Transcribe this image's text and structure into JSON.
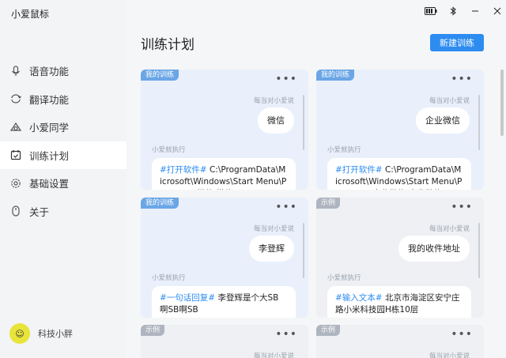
{
  "app": {
    "title": "小爱鼠标"
  },
  "topbar": {
    "battery_icon": "battery-icon",
    "bluetooth_icon": "bluetooth-icon"
  },
  "nav": {
    "items": [
      {
        "label": "语音功能",
        "icon": "microphone-icon",
        "active": false
      },
      {
        "label": "翻译功能",
        "icon": "refresh-icon",
        "active": false
      },
      {
        "label": "小爱同学",
        "icon": "xiaoai-icon",
        "active": false
      },
      {
        "label": "训练计划",
        "icon": "calendar-icon",
        "active": true
      },
      {
        "label": "基础设置",
        "icon": "gear-icon",
        "active": false
      },
      {
        "label": "关于",
        "icon": "mouse-icon",
        "active": false
      }
    ]
  },
  "user": {
    "name": "科技小胖"
  },
  "page": {
    "title": "训练计划",
    "new_button": "新建训练"
  },
  "cards": [
    {
      "tag": "我的训练",
      "said_label": "每当对小爱说",
      "phrase": "微信",
      "exec_label": "小爱就执行",
      "action_keyword": "#打开软件#",
      "action_text": " C:\\ProgramData\\Microsoft\\Windows\\Start Menu\\Programs\\微信\\微信.lnk"
    },
    {
      "tag": "我的训练",
      "said_label": "每当对小爱说",
      "phrase": "企业微信",
      "exec_label": "小爱就执行",
      "action_keyword": "#打开软件#",
      "action_text": " C:\\ProgramData\\Microsoft\\Windows\\Start Menu\\Programs\\企业微信\\企业微信.lnk"
    },
    {
      "tag": "我的训练",
      "said_label": "每当对小爱说",
      "phrase": "李登辉",
      "exec_label": "小爱就执行",
      "action_keyword": "#一句话回复#",
      "action_text": " 李登辉是个大SB 啊SB啊SB"
    },
    {
      "tag": "示例",
      "said_label": "每当对小爱说",
      "phrase": "我的收件地址",
      "exec_label": "小爱就执行",
      "action_keyword": "#输入文本#",
      "action_text": " 北京市海淀区安宁庄路小米科技园H栋10层"
    },
    {
      "tag": "示例",
      "said_label": "每当对小爱说",
      "phrase": "",
      "exec_label": "",
      "action_keyword": "",
      "action_text": ""
    },
    {
      "tag": "示例",
      "said_label": "每当对小爱说",
      "phrase": "",
      "exec_label": "",
      "action_keyword": "",
      "action_text": ""
    }
  ],
  "colors": {
    "accent": "#2d8cf0",
    "card_bg": "#e9f0fb",
    "tag_mine": "#6aa6e6",
    "tag_example": "#aeb5c0"
  }
}
